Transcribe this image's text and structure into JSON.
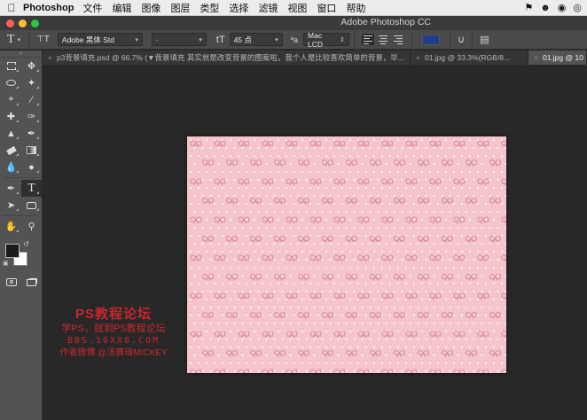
{
  "menubar": {
    "apple_icon": "apple-icon",
    "app_name": "Photoshop",
    "menus": [
      "文件",
      "编辑",
      "图像",
      "图层",
      "类型",
      "选择",
      "滤镜",
      "视图",
      "窗口",
      "帮助"
    ],
    "status_icons": [
      "flag-icon",
      "penguin-icon",
      "wechat-icon",
      "weibo-icon"
    ]
  },
  "window": {
    "title": "Adobe Photoshop CC",
    "traffic_lights": [
      "#ff5f57",
      "#febc2e",
      "#28c840"
    ]
  },
  "options_bar": {
    "tool_icon_glyph": "T",
    "font_family": "Adobe 黑体 Std",
    "font_style": "-",
    "font_size": "45 点",
    "aa_label": "ªa",
    "anti_alias": "Mac LCD",
    "text_color": "#1f3f8a"
  },
  "tabs": [
    {
      "label": "p3背景填充.psd @ 66.7% (▼背景填充 其实就是改变背景的图案啦，我个人是比较喜欢简单的背景，毕...",
      "active": false
    },
    {
      "label": "01.jpg @ 33.3%(RGB/8...",
      "active": false
    },
    {
      "label": "01.jpg @ 10",
      "active": true
    }
  ],
  "tools": [
    [
      "move-tool-icon",
      "marquee-tool-icon"
    ],
    [
      "lasso-tool-icon",
      "magic-wand-icon"
    ],
    [
      "crop-tool-icon",
      "eyedropper-icon"
    ],
    [
      "healing-brush-icon",
      "brush-tool-icon"
    ],
    [
      "clone-stamp-icon",
      "history-brush-icon"
    ],
    [
      "eraser-tool-icon",
      "gradient-tool-icon"
    ],
    [
      "blur-tool-icon",
      "dodge-tool-icon"
    ],
    [
      "pen-tool-icon",
      "type-tool-icon"
    ],
    [
      "path-select-icon",
      "shape-tool-icon"
    ],
    [
      "hand-tool-icon",
      "zoom-tool-icon"
    ]
  ],
  "active_tool": "type-tool-icon",
  "colors": {
    "foreground": "#1a1a1a",
    "background": "#ffffff",
    "canvas_pink": "#f5c4cc",
    "bow_color": "#d98e9b",
    "dot_color": "#ffffff"
  },
  "watermark": {
    "line1": "PS教程论坛",
    "line2": "学PS，就到PS教程论坛",
    "line3": "BBS.16XX8.COM",
    "line4": "作者微博 @汤赛琦MICKEY"
  }
}
